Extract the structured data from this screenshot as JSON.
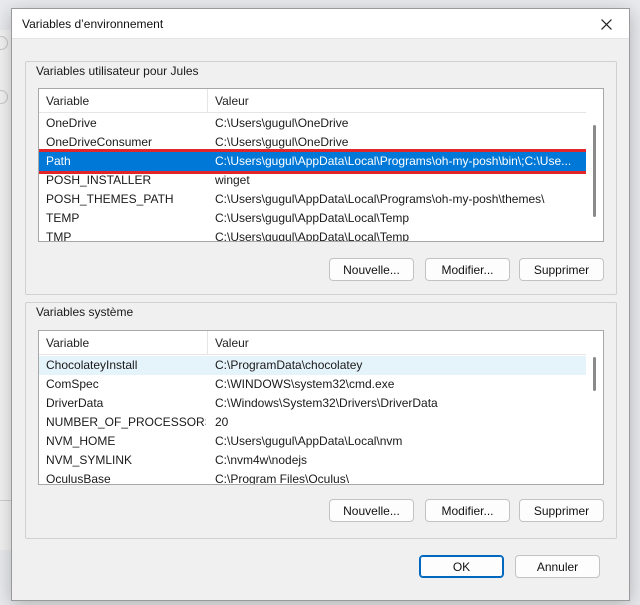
{
  "window": {
    "title": "Variables d’environnement"
  },
  "user_vars": {
    "legend": "Variables utilisateur pour Jules",
    "columns": [
      "Variable",
      "Valeur"
    ],
    "rows": [
      {
        "name": "OneDrive",
        "value": "C:\\Users\\gugul\\OneDrive"
      },
      {
        "name": "OneDriveConsumer",
        "value": "C:\\Users\\gugul\\OneDrive"
      },
      {
        "name": "Path",
        "value": "C:\\Users\\gugul\\AppData\\Local\\Programs\\oh-my-posh\\bin\\;C:\\Use..."
      },
      {
        "name": "POSH_INSTALLER",
        "value": "winget"
      },
      {
        "name": "POSH_THEMES_PATH",
        "value": "C:\\Users\\gugul\\AppData\\Local\\Programs\\oh-my-posh\\themes\\"
      },
      {
        "name": "TEMP",
        "value": "C:\\Users\\gugul\\AppData\\Local\\Temp"
      },
      {
        "name": "TMP",
        "value": "C:\\Users\\gugul\\AppData\\Local\\Temp"
      }
    ],
    "selected_index": 2,
    "buttons": {
      "new": "Nouvelle...",
      "edit": "Modifier...",
      "delete": "Supprimer"
    }
  },
  "system_vars": {
    "legend": "Variables système",
    "columns": [
      "Variable",
      "Valeur"
    ],
    "rows": [
      {
        "name": "ChocolateyInstall",
        "value": "C:\\ProgramData\\chocolatey"
      },
      {
        "name": "ComSpec",
        "value": "C:\\WINDOWS\\system32\\cmd.exe"
      },
      {
        "name": "DriverData",
        "value": "C:\\Windows\\System32\\Drivers\\DriverData"
      },
      {
        "name": "NUMBER_OF_PROCESSORS",
        "value": "20"
      },
      {
        "name": "NVM_HOME",
        "value": "C:\\Users\\gugul\\AppData\\Local\\nvm"
      },
      {
        "name": "NVM_SYMLINK",
        "value": "C:\\nvm4w\\nodejs"
      },
      {
        "name": "OculusBase",
        "value": "C:\\Program Files\\Oculus\\"
      }
    ],
    "buttons": {
      "new": "Nouvelle...",
      "edit": "Modifier...",
      "delete": "Supprimer"
    }
  },
  "footer": {
    "ok": "OK",
    "cancel": "Annuler"
  },
  "colors": {
    "selection": "#0078d7",
    "highlight_outline": "#e0252b",
    "accent": "#0067c0"
  }
}
